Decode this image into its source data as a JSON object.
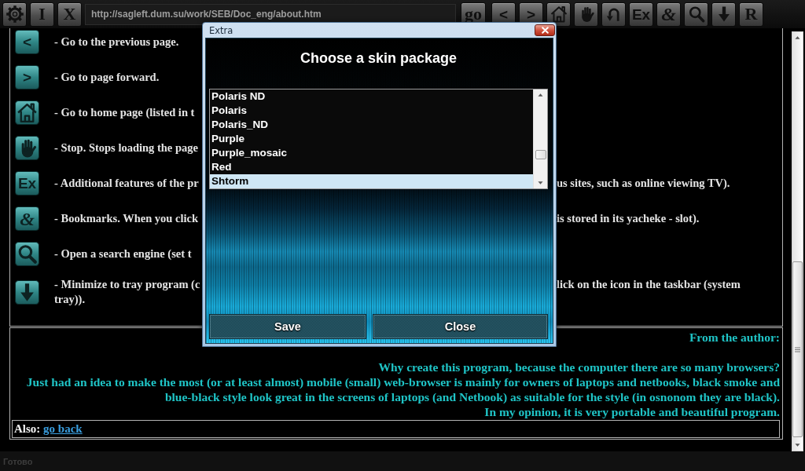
{
  "toolbar": {
    "buttons_left": [
      {
        "kind": "gear"
      },
      {
        "kind": "serif",
        "label": "I"
      },
      {
        "kind": "serif",
        "label": "X"
      }
    ],
    "address": {
      "value": "http://sagleft.dum.su/work/SEB/Doc_eng/about.htm"
    },
    "go_button": "go",
    "buttons_right": [
      {
        "kind": "sans",
        "label": "<"
      },
      {
        "kind": "sans",
        "label": ">"
      },
      {
        "kind": "home"
      },
      {
        "kind": "hand"
      },
      {
        "kind": "undo"
      },
      {
        "kind": "sans",
        "label": "Ex"
      },
      {
        "kind": "script",
        "label": "&"
      },
      {
        "kind": "search"
      },
      {
        "kind": "down"
      },
      {
        "kind": "serif",
        "label": "R"
      }
    ]
  },
  "help_rows": [
    {
      "kind": "sans",
      "label": "<",
      "text_left": "- Go to the previous page."
    },
    {
      "kind": "sans",
      "label": ">",
      "text_left": "- Go to page forward."
    },
    {
      "kind": "home",
      "text_left": "- Go to home page (listed in t"
    },
    {
      "kind": "hand",
      "text_left": "- Stop. Stops loading the page"
    },
    {
      "kind": "sans",
      "label": "Ex",
      "text_left": "- Additional features of the pr",
      "text_right": "us sites, such as online viewing TV)."
    },
    {
      "kind": "script",
      "label": "&",
      "text_left": "- Bookmarks. When you click",
      "text_right": "is stored in its yacheke - slot)."
    },
    {
      "kind": "search",
      "text_left": "- Open a search engine (set t"
    },
    {
      "kind": "down",
      "text_left": "- Minimize to tray program (c",
      "text_right": "lick on the icon in the taskbar (system",
      "second_line": "tray))."
    }
  ],
  "author_note": {
    "heading": "From the author:",
    "question": "Why create this program, because the computer there are so many browsers?",
    "paragraph": "Just had an idea to make the most (or at least almost) mobile (small) web-browser is mainly for owners of laptops and netbooks, black smoke and blue-black style look great in the screens of laptops (and Netbook) as suitable for the style (in osnonom they are black).",
    "closing": "In my opinion, it is very portable and beautiful program."
  },
  "also": {
    "label": "Also:",
    "link": "go back"
  },
  "status_bar": {
    "text": "Готово"
  },
  "dialog": {
    "title": "Extra",
    "heading": "Choose a skin package",
    "skins": [
      {
        "name": "Polaris ND",
        "selected": false
      },
      {
        "name": "Polaris",
        "selected": false
      },
      {
        "name": "Polaris_ND",
        "selected": false
      },
      {
        "name": "Purple",
        "selected": false
      },
      {
        "name": "Purple_mosaic",
        "selected": false
      },
      {
        "name": "Red",
        "selected": false
      },
      {
        "name": "Shtorm",
        "selected": true
      }
    ],
    "buttons": [
      "Save",
      "Close"
    ]
  }
}
